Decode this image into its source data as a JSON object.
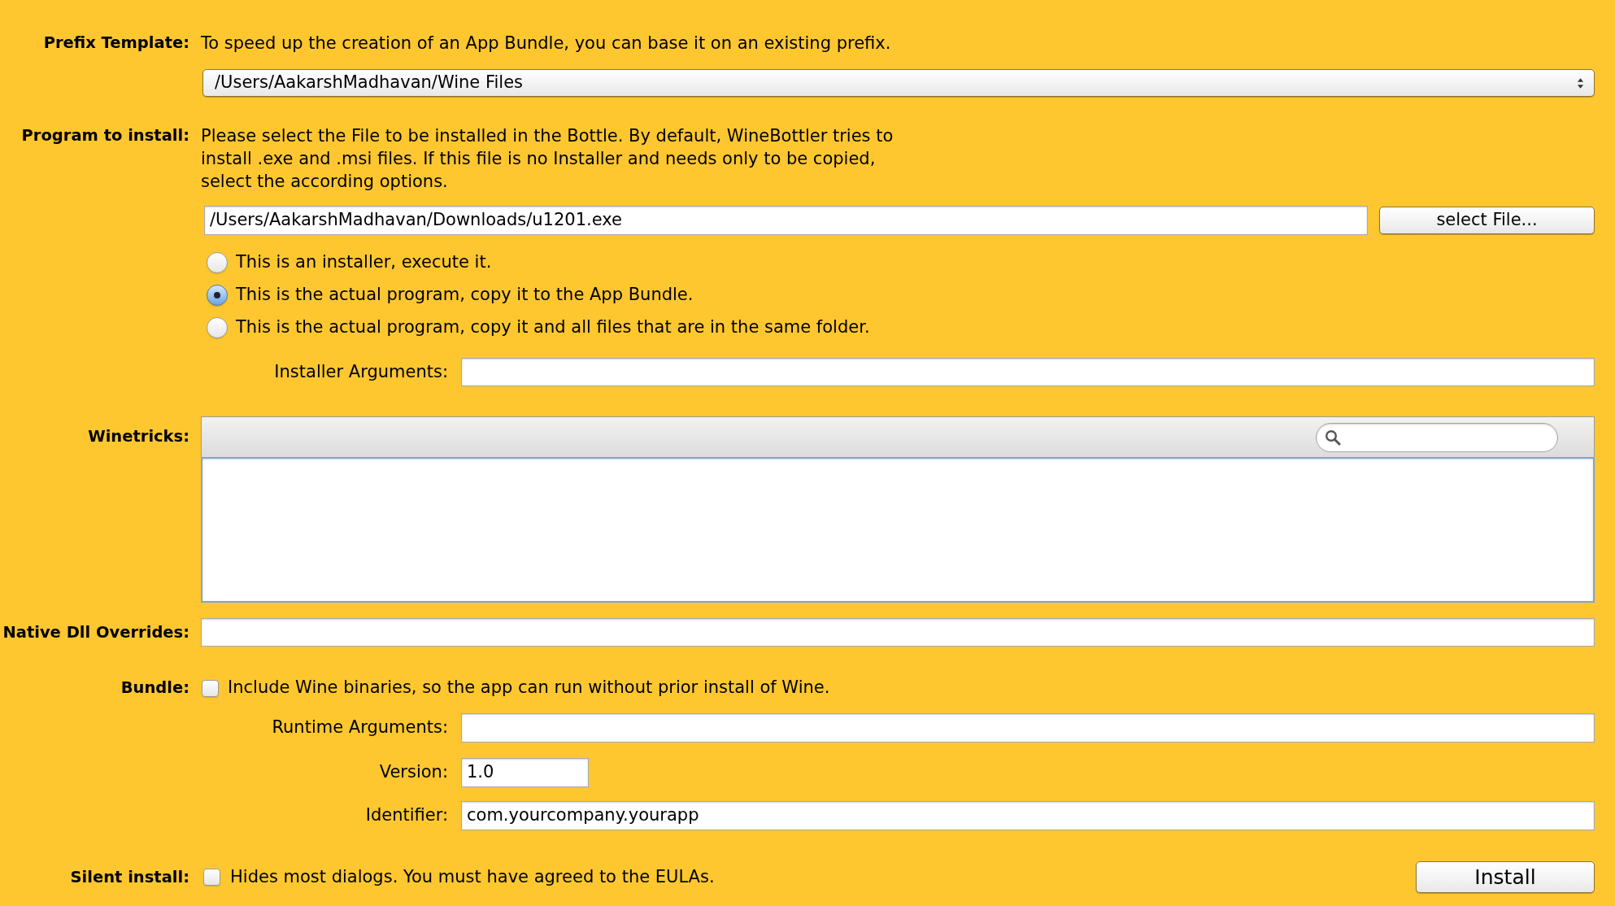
{
  "prefix_template": {
    "label": "Prefix Template:",
    "description": "To speed up the creation of an App Bundle, you can base it on an existing prefix.",
    "popup": {
      "value": "/Users/AakarshMadhavan/Wine Files"
    }
  },
  "program_to_install": {
    "label": "Program to install:",
    "description": "Please select the File to be installed in the Bottle. By default, WineBottler tries to install .exe and .msi files. If this file is no Installer and needs only to be copied, select the according options.",
    "file_field": {
      "value": "/Users/AakarshMadhavan/Downloads/u1201.exe"
    },
    "select_button": "select File...",
    "options": [
      {
        "label": "This is an installer, execute it.",
        "selected": false
      },
      {
        "label": "This is the actual program, copy it to the App Bundle.",
        "selected": true
      },
      {
        "label": "This is the actual program, copy it and all files that are in the same folder.",
        "selected": false
      }
    ],
    "installer_arguments": {
      "label": "Installer Arguments:"
    }
  },
  "winetricks": {
    "label": "Winetricks:"
  },
  "native_dll_overrides": {
    "label": "Native Dll Overrides:"
  },
  "bundle": {
    "label": "Bundle:",
    "checkbox": {
      "text": "Include Wine binaries, so the app can run without prior install of Wine.",
      "checked": false
    },
    "runtime_arguments": {
      "label": "Runtime Arguments:"
    },
    "version": {
      "label": "Version:",
      "value": "1.0"
    },
    "identifier": {
      "label": "Identifier:",
      "value": "com.yourcompany.yourapp"
    }
  },
  "silent_install": {
    "label": "Silent install:",
    "checkbox": {
      "text": "Hides most dialogs. You must have agreed to the EULAs.",
      "checked": false
    }
  },
  "install_button": "Install"
}
